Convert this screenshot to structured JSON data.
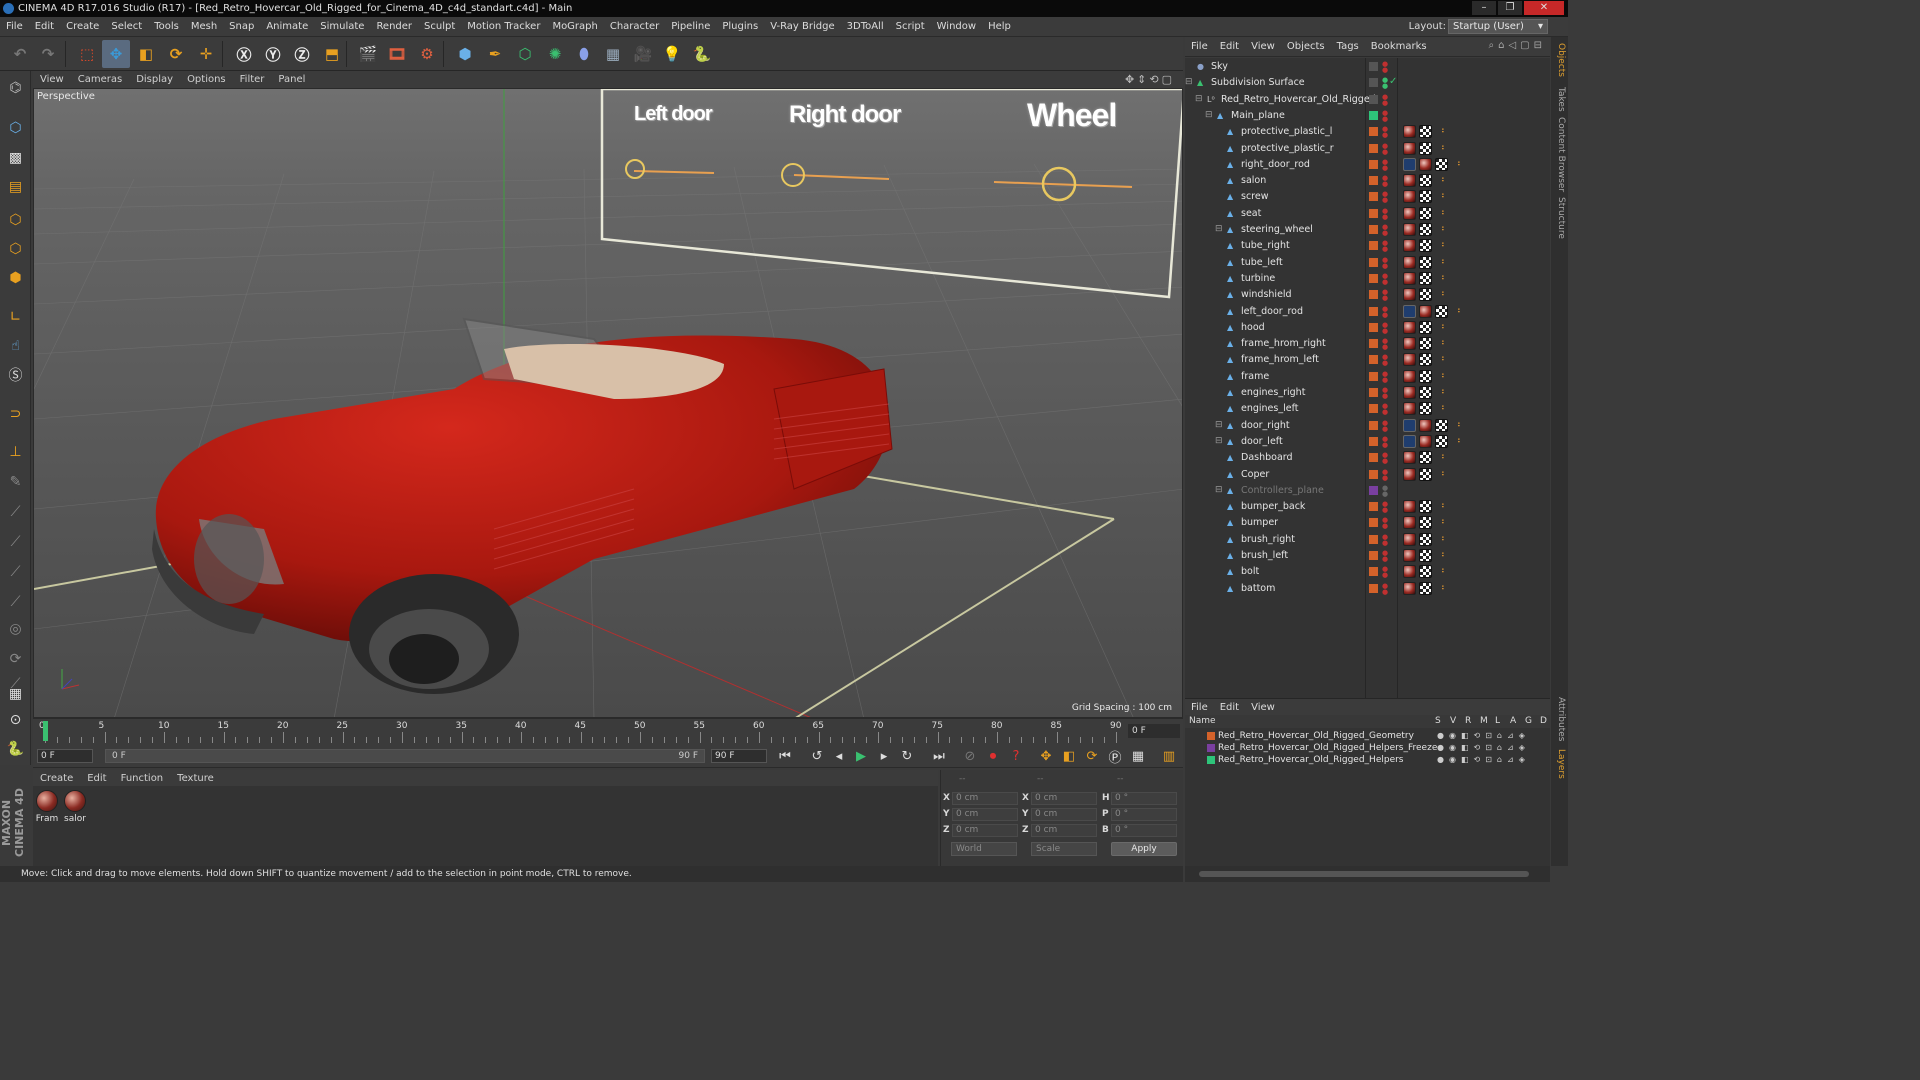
{
  "window": {
    "title": "CINEMA 4D R17.016 Studio (R17) - [Red_Retro_Hovercar_Old_Rigged_for_Cinema_4D_c4d_standart.c4d] - Main"
  },
  "menubar": {
    "items": [
      "File",
      "Edit",
      "Create",
      "Select",
      "Tools",
      "Mesh",
      "Snap",
      "Animate",
      "Simulate",
      "Render",
      "Sculpt",
      "Motion Tracker",
      "MoGraph",
      "Character",
      "Pipeline",
      "Plugins",
      "V-Ray Bridge",
      "3DToAll",
      "Script",
      "Window",
      "Help"
    ],
    "layout_label": "Layout:",
    "layout_value": "Startup (User)"
  },
  "viewport": {
    "menu": [
      "View",
      "Cameras",
      "Display",
      "Options",
      "Filter",
      "Panel"
    ],
    "label": "Perspective",
    "grid_spacing": "Grid Spacing : 100 cm",
    "overlay_labels": [
      "Left door",
      "Right door",
      "Wheel"
    ]
  },
  "timeline": {
    "ticks": [
      "0",
      "5",
      "10",
      "15",
      "20",
      "25",
      "30",
      "35",
      "40",
      "45",
      "50",
      "55",
      "60",
      "65",
      "70",
      "75",
      "80",
      "85",
      "90"
    ],
    "end_field": "0 F",
    "current_frame": "0 F",
    "range_start": "0 F",
    "range_end": "90 F",
    "max_frame": "90 F"
  },
  "materials": {
    "menu": [
      "Create",
      "Edit",
      "Function",
      "Texture"
    ],
    "items": [
      "Fram",
      "salor"
    ]
  },
  "coords": {
    "header": [
      "--",
      "--",
      "--"
    ],
    "rows": [
      {
        "a": "X",
        "av": "0 cm",
        "b": "X",
        "bv": "0 cm",
        "c": "H",
        "cv": "0 °"
      },
      {
        "a": "Y",
        "av": "0 cm",
        "b": "Y",
        "bv": "0 cm",
        "c": "P",
        "cv": "0 °"
      },
      {
        "a": "Z",
        "av": "0 cm",
        "b": "Z",
        "bv": "0 cm",
        "c": "B",
        "cv": "0 °"
      }
    ],
    "space": "World",
    "mode": "Scale",
    "apply": "Apply"
  },
  "status": "Move: Click and drag to move elements. Hold down SHIFT to quantize movement / add to the selection in point mode, CTRL to remove.",
  "brand": "MAXON CINEMA 4D",
  "object_manager": {
    "menu": [
      "File",
      "Edit",
      "View",
      "Objects",
      "Tags",
      "Bookmarks"
    ],
    "objects": [
      {
        "name": "Sky",
        "indent": 0,
        "icon": "sky-icon",
        "tags": []
      },
      {
        "name": "Subdivision Surface",
        "indent": 0,
        "icon": "subdivision-icon",
        "tags": [],
        "check": true
      },
      {
        "name": "Red_Retro_Hovercar_Old_Rigged",
        "indent": 1,
        "icon": "null-icon",
        "tags": []
      },
      {
        "name": "Main_plane",
        "indent": 2,
        "icon": "polygon-icon",
        "tags": [],
        "green": true
      },
      {
        "name": "protective_plastic_l",
        "indent": 3,
        "tags": [
          "mat",
          "check",
          "dots"
        ]
      },
      {
        "name": "protective_plastic_r",
        "indent": 3,
        "tags": [
          "mat",
          "check",
          "dots"
        ]
      },
      {
        "name": "right_door_rod",
        "indent": 3,
        "tags": [
          "uvw",
          "mat",
          "check",
          "dots"
        ]
      },
      {
        "name": "salon",
        "indent": 3,
        "tags": [
          "mat",
          "check",
          "dots"
        ]
      },
      {
        "name": "screw",
        "indent": 3,
        "tags": [
          "mat",
          "check",
          "dots"
        ]
      },
      {
        "name": "seat",
        "indent": 3,
        "tags": [
          "mat",
          "check",
          "dots"
        ]
      },
      {
        "name": "steering_wheel",
        "indent": 3,
        "tags": [
          "mat",
          "check",
          "dots"
        ],
        "expand": true
      },
      {
        "name": "tube_right",
        "indent": 3,
        "tags": [
          "mat",
          "check",
          "dots"
        ]
      },
      {
        "name": "tube_left",
        "indent": 3,
        "tags": [
          "mat",
          "check",
          "dots"
        ]
      },
      {
        "name": "turbine",
        "indent": 3,
        "tags": [
          "mat",
          "check",
          "dots"
        ]
      },
      {
        "name": "windshield",
        "indent": 3,
        "tags": [
          "mat",
          "check",
          "dots"
        ]
      },
      {
        "name": "left_door_rod",
        "indent": 3,
        "tags": [
          "uvw",
          "mat",
          "check",
          "dots"
        ]
      },
      {
        "name": "hood",
        "indent": 3,
        "tags": [
          "mat",
          "check",
          "dots"
        ]
      },
      {
        "name": "frame_hrom_right",
        "indent": 3,
        "tags": [
          "mat",
          "check",
          "dots"
        ]
      },
      {
        "name": "frame_hrom_left",
        "indent": 3,
        "tags": [
          "mat",
          "check",
          "dots"
        ]
      },
      {
        "name": "frame",
        "indent": 3,
        "tags": [
          "mat",
          "check",
          "dots"
        ]
      },
      {
        "name": "engines_right",
        "indent": 3,
        "tags": [
          "mat",
          "check",
          "dots"
        ]
      },
      {
        "name": "engines_left",
        "indent": 3,
        "tags": [
          "mat",
          "check",
          "dots"
        ]
      },
      {
        "name": "door_right",
        "indent": 3,
        "tags": [
          "uvw",
          "mat",
          "check",
          "dots"
        ],
        "expand": true
      },
      {
        "name": "door_left",
        "indent": 3,
        "tags": [
          "uvw",
          "mat",
          "check",
          "dots"
        ],
        "expand": true
      },
      {
        "name": "Dashboard",
        "indent": 3,
        "tags": [
          "mat",
          "check",
          "dots"
        ]
      },
      {
        "name": "Coper",
        "indent": 3,
        "tags": [
          "mat",
          "check",
          "dots"
        ]
      },
      {
        "name": "Controllers_plane",
        "indent": 3,
        "tags": [],
        "dim": true,
        "expand": true
      },
      {
        "name": "bumper_back",
        "indent": 3,
        "tags": [
          "mat",
          "check",
          "dots"
        ]
      },
      {
        "name": "bumper",
        "indent": 3,
        "tags": [
          "mat",
          "check",
          "dots"
        ]
      },
      {
        "name": "brush_right",
        "indent": 3,
        "tags": [
          "mat",
          "check",
          "dots"
        ]
      },
      {
        "name": "brush_left",
        "indent": 3,
        "tags": [
          "mat",
          "check",
          "dots"
        ]
      },
      {
        "name": "bolt",
        "indent": 3,
        "tags": [
          "mat",
          "check",
          "dots"
        ]
      },
      {
        "name": "battom",
        "indent": 3,
        "tags": [
          "mat",
          "check",
          "dots"
        ]
      }
    ]
  },
  "layers": {
    "menu": [
      "File",
      "Edit",
      "View"
    ],
    "header_name": "Name",
    "header_flags": [
      "S",
      "V",
      "R",
      "M",
      "L",
      "A",
      "G",
      "D"
    ],
    "items": [
      {
        "name": "Red_Retro_Hovercar_Old_Rigged_Geometry",
        "color": "#d4622a"
      },
      {
        "name": "Red_Retro_Hovercar_Old_Rigged_Helpers_Freeze",
        "color": "#7a3fa0"
      },
      {
        "name": "Red_Retro_Hovercar_Old_Rigged_Helpers",
        "color": "#2ec47a"
      }
    ]
  },
  "right_tabs": [
    "Objects",
    "Takes",
    "Content Browser",
    "Structure",
    "Attributes",
    "Layers"
  ],
  "colors": {
    "accent": "#5a6b80",
    "layer_orange": "#d4622a",
    "car_red": "#b01a12"
  }
}
